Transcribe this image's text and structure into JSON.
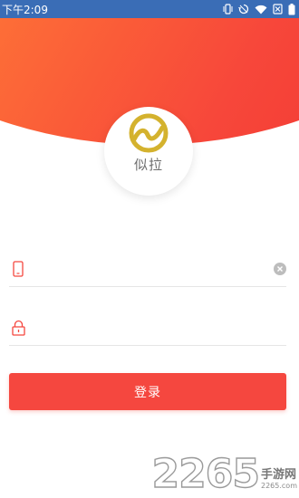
{
  "status_bar": {
    "time": "下午2:09",
    "icons": [
      "vibrate-icon",
      "rotate-icon",
      "wifi-icon",
      "sim-blocked-icon",
      "battery-icon"
    ]
  },
  "app": {
    "logo_text": "似拉"
  },
  "form": {
    "phone": {
      "value": "",
      "placeholder": "",
      "icon": "phone-icon"
    },
    "password": {
      "value": "",
      "placeholder": "",
      "icon": "lock-icon"
    },
    "login_label": "登录"
  },
  "colors": {
    "accent": "#f5473f",
    "gradient_start": "#ff9a40",
    "gradient_end": "#ef2f2f",
    "logo_gold": "#d4b22e",
    "status_bar": "#3a6db6"
  },
  "watermark": {
    "number": "2265",
    "text": "手游网",
    "domain": "2265.com"
  }
}
